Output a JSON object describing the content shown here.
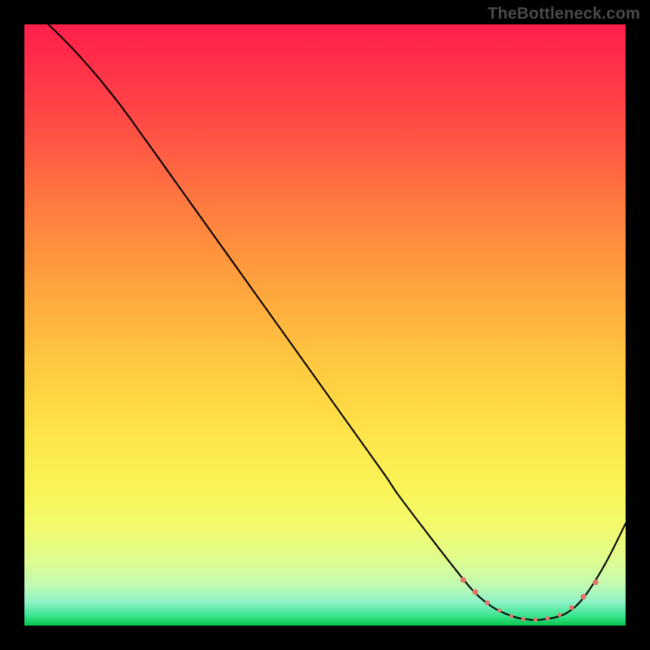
{
  "watermark": "TheBottleneck.com",
  "chart_data": {
    "type": "line",
    "title": "",
    "xlabel": "",
    "ylabel": "",
    "xlim": [
      0,
      100
    ],
    "ylim": [
      0,
      100
    ],
    "grid": false,
    "legend": false,
    "gradient_colors": {
      "top": "#ff1f4b",
      "upper_mid": "#ff933e",
      "mid": "#ffd644",
      "lower_mid": "#f1fb6f",
      "bottom": "#08c24a"
    },
    "series": [
      {
        "name": "bottleneck-curve",
        "color": "#000000",
        "stroke_width": 2,
        "x": [
          4,
          8,
          12,
          16,
          20,
          25,
          30,
          35,
          40,
          45,
          50,
          55,
          60,
          62,
          65,
          70,
          74,
          76,
          78,
          80,
          82,
          84,
          86,
          88,
          90,
          92,
          94,
          97,
          100
        ],
        "values": [
          100,
          96,
          91.5,
          86.5,
          81,
          74,
          67,
          60,
          53,
          46,
          39,
          32,
          25,
          22,
          18,
          11.5,
          6.5,
          4.5,
          3,
          2,
          1.3,
          1,
          1,
          1.3,
          2,
          3.5,
          6,
          11,
          17
        ]
      }
    ],
    "markers": {
      "name": "highlight-dots",
      "color": "#e57368",
      "radius_sequence": [
        3.5,
        3.5,
        3,
        2.6,
        2.6,
        2.6,
        2.6,
        2.6,
        2.6,
        3,
        3.5,
        3.5
      ],
      "x": [
        73,
        75,
        77,
        79,
        81,
        83,
        85,
        87,
        89,
        91,
        93,
        95
      ],
      "y": [
        7.6,
        5.6,
        3.8,
        2.5,
        1.6,
        1.1,
        1.0,
        1.2,
        1.8,
        3.0,
        4.8,
        7.2
      ]
    }
  }
}
